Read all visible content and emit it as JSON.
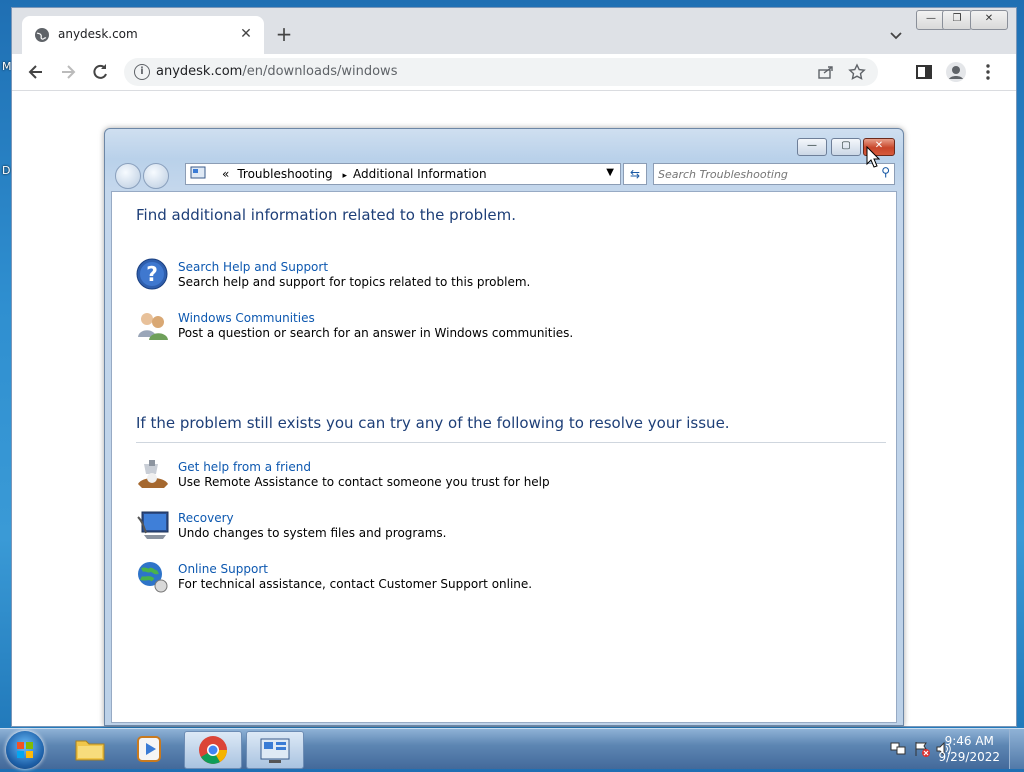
{
  "desktop": {
    "labels": [
      "M",
      "D"
    ]
  },
  "browser": {
    "tab_title": "anydesk.com",
    "close_tab": "✕",
    "new_tab": "+",
    "url_domain": "anydesk.com",
    "url_path": "/en/downloads/windows",
    "window_buttons": {
      "minimize": "—",
      "restore": "❐",
      "close": "✕"
    }
  },
  "dialog": {
    "window_buttons": {
      "minimize": "—",
      "maximize": "▢",
      "close": "✕"
    },
    "breadcrumb": {
      "prefix": "«",
      "items": [
        "Troubleshooting",
        "Additional Information"
      ],
      "separator": "▸"
    },
    "search_placeholder": "Search Troubleshooting",
    "heading1": "Find additional information related to the problem.",
    "section1": [
      {
        "title": "Search Help and Support",
        "desc": "Search help and support for topics related to this problem.",
        "icon": "help-question-icon"
      },
      {
        "title": "Windows Communities",
        "desc": "Post a question or search for an answer in Windows communities.",
        "icon": "people-icon"
      }
    ],
    "heading2": "If the problem still exists you can try any of the following to resolve your issue.",
    "section2": [
      {
        "title": "Get help from a friend",
        "desc": "Use Remote Assistance to contact someone you trust for help",
        "icon": "remote-assistance-icon"
      },
      {
        "title": "Recovery",
        "desc": "Undo changes to system files and programs.",
        "icon": "recovery-icon"
      },
      {
        "title": "Online Support",
        "desc": "For technical assistance, contact Customer Support online.",
        "icon": "globe-support-icon"
      }
    ]
  },
  "taskbar": {
    "time": "9:46 AM",
    "date": "9/29/2022"
  }
}
